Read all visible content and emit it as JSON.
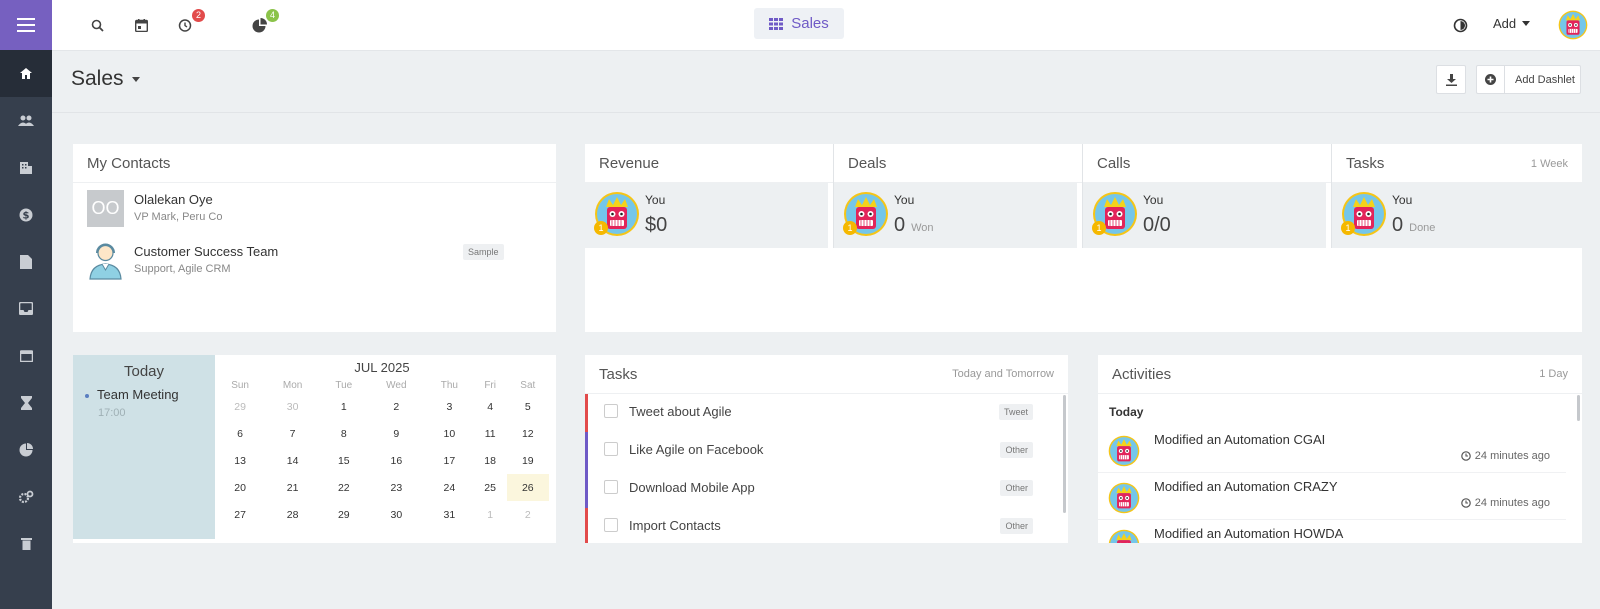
{
  "topbar": {
    "reminders_badge": "2",
    "reports_badge": "4",
    "dashboard_selector": "Sales",
    "add_menu": "Add"
  },
  "header": {
    "title": "Sales",
    "add_dashlet": "Add Dashlet"
  },
  "contacts": {
    "title": "My Contacts",
    "items": [
      {
        "initials": "OO",
        "name": "Olalekan Oye",
        "subtitle": "VP Mark, Peru Co",
        "tag": ""
      },
      {
        "initials": "",
        "name": "Customer Success Team",
        "subtitle": "Support, Agile CRM",
        "tag": "Sample"
      }
    ]
  },
  "stats": {
    "period": "1 Week",
    "cards": [
      {
        "title": "Revenue",
        "user": "You",
        "value": "$0",
        "suffix": "",
        "rank": "1"
      },
      {
        "title": "Deals",
        "user": "You",
        "value": "0",
        "suffix": "Won",
        "rank": "1"
      },
      {
        "title": "Calls",
        "user": "You",
        "value": "0/0",
        "suffix": "",
        "rank": "1"
      },
      {
        "title": "Tasks",
        "user": "You",
        "value": "0",
        "suffix": "Done",
        "rank": "1"
      }
    ]
  },
  "calendar": {
    "today_label": "Today",
    "events": [
      {
        "title": "Team Meeting",
        "time": "17:00"
      }
    ],
    "month": "JUL 2025",
    "weekdays": [
      "Sun",
      "Mon",
      "Tue",
      "Wed",
      "Thu",
      "Fri",
      "Sat"
    ],
    "weeks": [
      [
        "29",
        "30",
        "1",
        "2",
        "3",
        "4",
        "5"
      ],
      [
        "6",
        "7",
        "8",
        "9",
        "10",
        "11",
        "12"
      ],
      [
        "13",
        "14",
        "15",
        "16",
        "17",
        "18",
        "19"
      ],
      [
        "20",
        "21",
        "22",
        "23",
        "24",
        "25",
        "26"
      ],
      [
        "27",
        "28",
        "29",
        "30",
        "31",
        "1",
        "2"
      ]
    ],
    "highlight": "26"
  },
  "tasks": {
    "title": "Tasks",
    "range": "Today and Tomorrow",
    "items": [
      {
        "title": "Tweet about Agile",
        "tag": "Tweet",
        "color": "#e24b4b"
      },
      {
        "title": "Like Agile on Facebook",
        "tag": "Other",
        "color": "#6f5ac6"
      },
      {
        "title": "Download Mobile App",
        "tag": "Other",
        "color": "#6f5ac6"
      },
      {
        "title": "Import Contacts",
        "tag": "Other",
        "color": "#e24b4b"
      }
    ]
  },
  "activities": {
    "title": "Activities",
    "range": "1 Day",
    "group": "Today",
    "items": [
      {
        "text": "Modified an Automation CGAI",
        "time": "24 minutes ago"
      },
      {
        "text": "Modified an Automation CRAZY",
        "time": "24 minutes ago"
      },
      {
        "text": "Modified an Automation HOWDA",
        "time": ""
      }
    ]
  },
  "colors": {
    "accent": "#6f5ac6",
    "sidebar": "#363f4d",
    "sidebar_top": "#7660c0",
    "badge_red": "#e24b4b",
    "badge_green": "#8bc34a"
  }
}
